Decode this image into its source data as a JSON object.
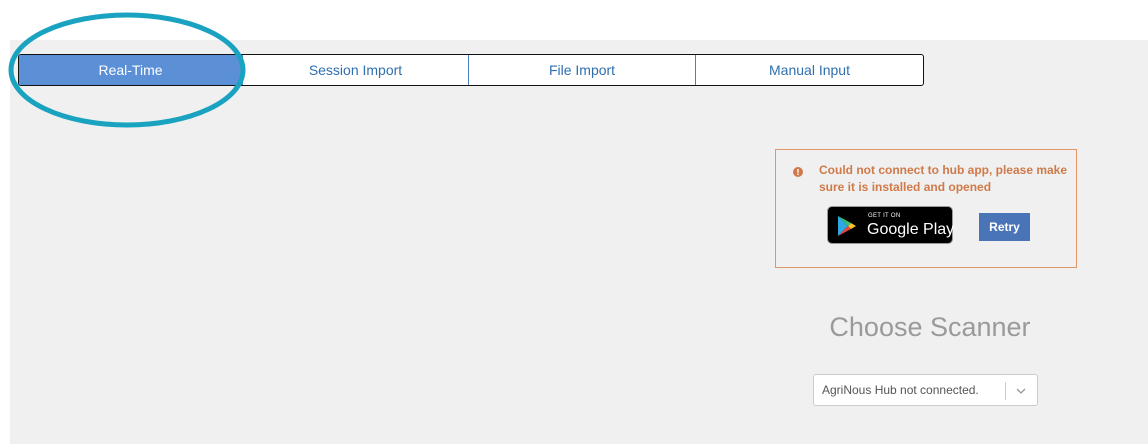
{
  "tabs": [
    {
      "label": "Real-Time",
      "active": true
    },
    {
      "label": "Session Import",
      "active": false
    },
    {
      "label": "File Import",
      "active": false
    },
    {
      "label": "Manual Input",
      "active": false
    }
  ],
  "hub_error": {
    "message": "Could not connect to hub app, please make sure it is installed and opened",
    "store_badge": {
      "top_text": "GET IT ON",
      "main_text": "Google Play"
    },
    "retry_label": "Retry"
  },
  "scanner": {
    "title": "Choose Scanner",
    "selected_value": "AgriNous Hub not connected."
  },
  "colors": {
    "active_tab": "#5b8fd6",
    "tab_text": "#2f6fb0",
    "highlight_ring": "#1aa3c0",
    "error_text": "#d07a4a",
    "error_border": "#e0956a",
    "retry_button": "#4a74b8"
  },
  "icons": {
    "error": "exclamation-circle-icon",
    "store": "google-play-icon",
    "select": "chevron-down-icon"
  }
}
